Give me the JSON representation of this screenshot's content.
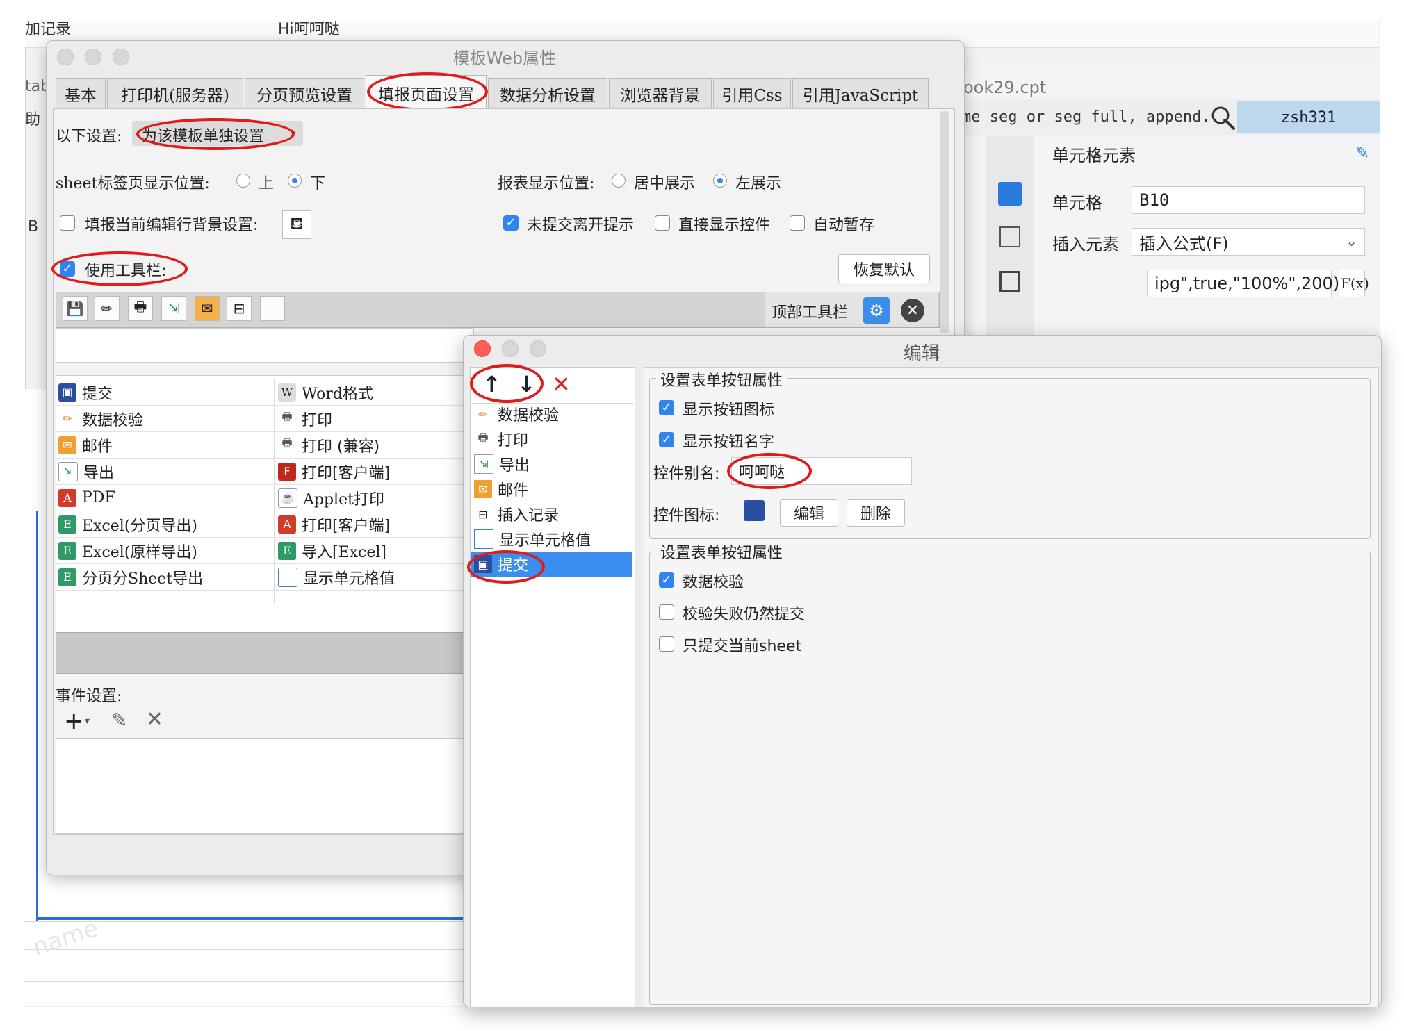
{
  "background": {
    "top_left_text": "加记录",
    "top_tab_text": "Hi呵呵哒",
    "left_frag_1": "tab",
    "left_frag_2": "助",
    "left_frag_3": "B",
    "file_tab": "ook29.cpt",
    "search_text": "me seg or seg full, append...",
    "user": "zsh331",
    "panel_title": "单元格元素",
    "cell_label": "单元格",
    "cell_value": "B10",
    "insert_label": "插入元素",
    "insert_value": "插入公式(F)",
    "formula_value": "ipg\",true,\"100%\",200)",
    "fx_label": "F(x)",
    "watermark": "name"
  },
  "main_window": {
    "title": "模板Web属性",
    "tabs": [
      "基本",
      "打印机(服务器)",
      "分页预览设置",
      "填报页面设置",
      "数据分析设置",
      "浏览器背景",
      "引用Css",
      "引用JavaScript"
    ],
    "active_tab": 3,
    "settings_label": "以下设置:",
    "settings_value": "为该模板单独设置",
    "sheet_pos_label": "sheet标签页显示位置:",
    "sheet_pos_options": [
      "上",
      "下"
    ],
    "report_pos_label": "报表显示位置:",
    "report_pos_options": [
      "居中展示",
      "左展示"
    ],
    "bg_setting_label": "填报当前编辑行背景设置:",
    "unsubmitted_label": "未提交离开提示",
    "direct_show_label": "直接显示控件",
    "auto_save_label": "自动暂存",
    "use_toolbar_label": "使用工具栏:",
    "restore_button": "恢复默认",
    "toolbar_position": "顶部工具栏",
    "list_col1": [
      "提交",
      "数据校验",
      "邮件",
      "导出",
      "PDF",
      "Excel(分页导出)",
      "Excel(原样导出)",
      "分页分Sheet导出"
    ],
    "list_col2": [
      "Word格式",
      "打印",
      "打印 (兼容)",
      "打印[客户端]",
      "Applet打印",
      "打印[客户端]",
      "导入[Excel]",
      "显示单元格值"
    ],
    "events_label": "事件设置:"
  },
  "edit_dialog": {
    "title": "编辑",
    "items": [
      "数据校验",
      "打印",
      "导出",
      "邮件",
      "插入记录",
      "显示单元格值",
      "提交"
    ],
    "selected_index": 6,
    "group1_title": "设置表单按钮属性",
    "show_icon_label": "显示按钮图标",
    "show_name_label": "显示按钮名字",
    "alias_label": "控件别名:",
    "alias_value": "呵呵哒",
    "icon_label": "控件图标:",
    "edit_button": "编辑",
    "delete_button": "删除",
    "group2_title": "设置表单按钮属性",
    "validate_label": "数据校验",
    "submit_on_fail_label": "校验失败仍然提交",
    "submit_current_sheet_label": "只提交当前sheet"
  },
  "colors": {
    "annotation_red": "#e01b1b",
    "select_blue": "#3b8eed",
    "checkbox_blue": "#2f84f0"
  }
}
